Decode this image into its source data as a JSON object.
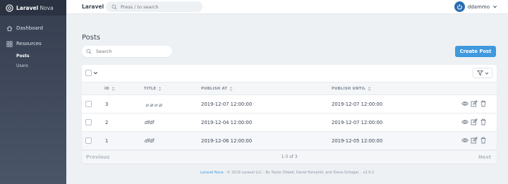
{
  "app": {
    "brand_bold": "Laravel",
    "brand_light": " Nova",
    "header_title": "Laravel"
  },
  "global_search": {
    "placeholder": "Press / to search"
  },
  "user": {
    "name": "ddammo"
  },
  "sidebar": {
    "dashboard": "Dashboard",
    "resources": "Resources",
    "items": [
      {
        "label": "Posts",
        "active": true
      },
      {
        "label": "Users",
        "active": false
      }
    ]
  },
  "main": {
    "title": "Posts",
    "search_placeholder": "Search",
    "create_label": "Create Post"
  },
  "table": {
    "columns": [
      "ID",
      "TITLE",
      "PUBLISH AT",
      "PUBLISH UNTIL"
    ],
    "rows": [
      {
        "id": "3",
        "title": "ㅇㄹㅇㄹ",
        "publish_at": "2019-12-07 12:00:00",
        "publish_until": "2019-12-07 12:00:00"
      },
      {
        "id": "2",
        "title": "dfdf",
        "publish_at": "2019-12-04 12:00:00",
        "publish_until": "2019-12-07 12:00:00"
      },
      {
        "id": "1",
        "title": "dfdf",
        "publish_at": "2019-12-06 12:00:00",
        "publish_until": "2019-12-05 12:00:00"
      }
    ]
  },
  "pagination": {
    "previous": "Previous",
    "info": "1-3 of 3",
    "next": "Next"
  },
  "footer": {
    "link": "Laravel Nova",
    "text": " · © 2019 Laravel LLC - By Taylor Otwell, David Hemphill, and Steve Schoger. · v2.9.2"
  },
  "colors": {
    "primary": "#4099de",
    "sidebar": "#353e4f",
    "text": "#3c4655"
  }
}
